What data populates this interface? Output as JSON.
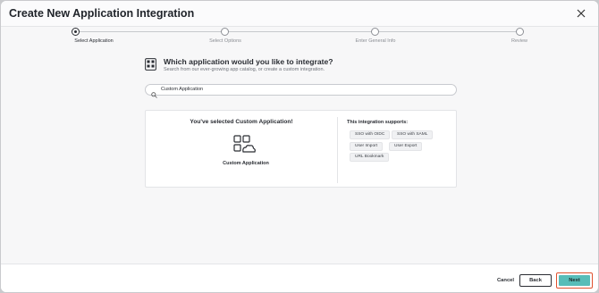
{
  "header": {
    "title": "Create New Application Integration",
    "close_icon": "close-icon"
  },
  "steps": [
    {
      "label": "Select Application",
      "active": true
    },
    {
      "label": "Select Options",
      "active": false
    },
    {
      "label": "Enter General Info",
      "active": false
    },
    {
      "label": "Review",
      "active": false
    }
  ],
  "question": {
    "title": "Which application would you like to integrate?",
    "subtitle": "Search from our ever-growing app catalog, or create a custom integration."
  },
  "search": {
    "value": "Custom Application",
    "icon": "search-icon"
  },
  "selection": {
    "heading": "You've selected Custom Application!",
    "app_name": "Custom Application",
    "app_icon": "custom-app-icon"
  },
  "supports": {
    "title": "This integration supports:",
    "tags": [
      "SSO with OIDC",
      "SSO with SAML",
      "User Import",
      "User Export",
      "URL Bookmark"
    ]
  },
  "footer": {
    "cancel_label": "Cancel",
    "back_label": "Back",
    "next_label": "Next"
  },
  "colors": {
    "accent": "#58bdb8",
    "highlight": "#e0522f",
    "text": "#2a2d33"
  }
}
